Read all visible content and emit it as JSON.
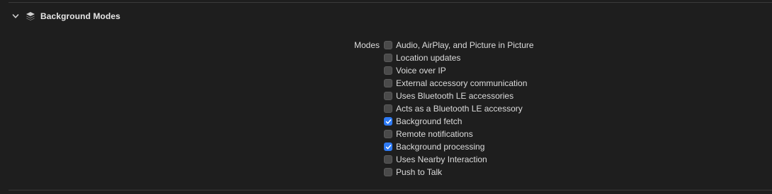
{
  "section": {
    "title": "Background Modes",
    "disclosure_icon": "chevron-down-icon",
    "icon": "stack-icon"
  },
  "modes": {
    "label": "Modes",
    "options": [
      {
        "label": "Audio, AirPlay, and Picture in Picture",
        "checked": false
      },
      {
        "label": "Location updates",
        "checked": false
      },
      {
        "label": "Voice over IP",
        "checked": false
      },
      {
        "label": "External accessory communication",
        "checked": false
      },
      {
        "label": "Uses Bluetooth LE accessories",
        "checked": false
      },
      {
        "label": "Acts as a Bluetooth LE accessory",
        "checked": false
      },
      {
        "label": "Background fetch",
        "checked": true
      },
      {
        "label": "Remote notifications",
        "checked": false
      },
      {
        "label": "Background processing",
        "checked": true
      },
      {
        "label": "Uses Nearby Interaction",
        "checked": false
      },
      {
        "label": "Push to Talk",
        "checked": false
      }
    ]
  },
  "colors": {
    "background": "#1e1e1e",
    "checkbox_checked": "#2f7bf5",
    "checkbox_unchecked": "#4a4a4a",
    "text": "#dcdcdc"
  }
}
